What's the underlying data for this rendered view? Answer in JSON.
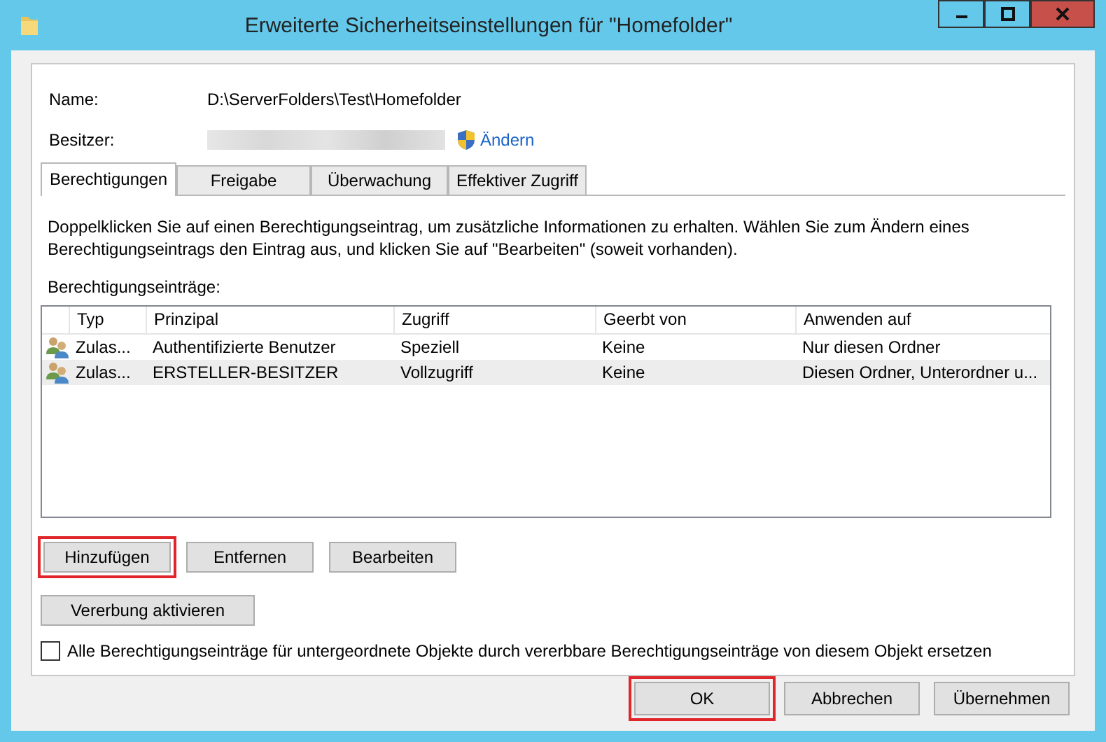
{
  "window": {
    "title": "Erweiterte Sicherheitseinstellungen für \"Homefolder\""
  },
  "name_field": {
    "label": "Name:",
    "value": "D:\\ServerFolders\\Test\\Homefolder"
  },
  "owner_field": {
    "label": "Besitzer:",
    "redacted": true,
    "link": "Ändern"
  },
  "tabs": [
    {
      "label": "Berechtigungen",
      "selected": true
    },
    {
      "label": "Freigabe",
      "selected": false
    },
    {
      "label": "Überwachung",
      "selected": false
    },
    {
      "label": "Effektiver Zugriff",
      "selected": false
    }
  ],
  "description": "Doppelklicken Sie auf einen Berechtigungseintrag, um zusätzliche Informationen zu erhalten. Wählen Sie zum Ändern eines Berechtigungseintrags den Eintrag aus, und klicken Sie auf \"Bearbeiten\" (soweit vorhanden).",
  "list_label": "Berechtigungseinträge:",
  "table": {
    "columns": [
      "Typ",
      "Prinzipal",
      "Zugriff",
      "Geerbt von",
      "Anwenden auf"
    ],
    "rows": [
      {
        "cells": [
          "Zulas...",
          "Authentifizierte Benutzer",
          "Speziell",
          "Keine",
          "Nur diesen Ordner"
        ],
        "selected": false
      },
      {
        "cells": [
          "Zulas...",
          "ERSTELLER-BESITZER",
          "Vollzugriff",
          "Keine",
          "Diesen Ordner, Unterordner u..."
        ],
        "selected": true
      }
    ]
  },
  "entry_buttons": [
    {
      "label": "Hinzufügen",
      "highlighted": true
    },
    {
      "label": "Entfernen",
      "highlighted": false
    },
    {
      "label": "Bearbeiten",
      "highlighted": false
    }
  ],
  "inheritance_button": {
    "label": "Vererbung aktivieren"
  },
  "replace_checkbox": {
    "label": "Alle Berechtigungseinträge für untergeordnete Objekte durch vererbbare Berechtigungseinträge von diesem Objekt ersetzen",
    "checked": false
  },
  "dialog_buttons": [
    {
      "label": "OK",
      "highlighted": true
    },
    {
      "label": "Abbrechen",
      "highlighted": false
    },
    {
      "label": "Übernehmen",
      "highlighted": false
    }
  ]
}
